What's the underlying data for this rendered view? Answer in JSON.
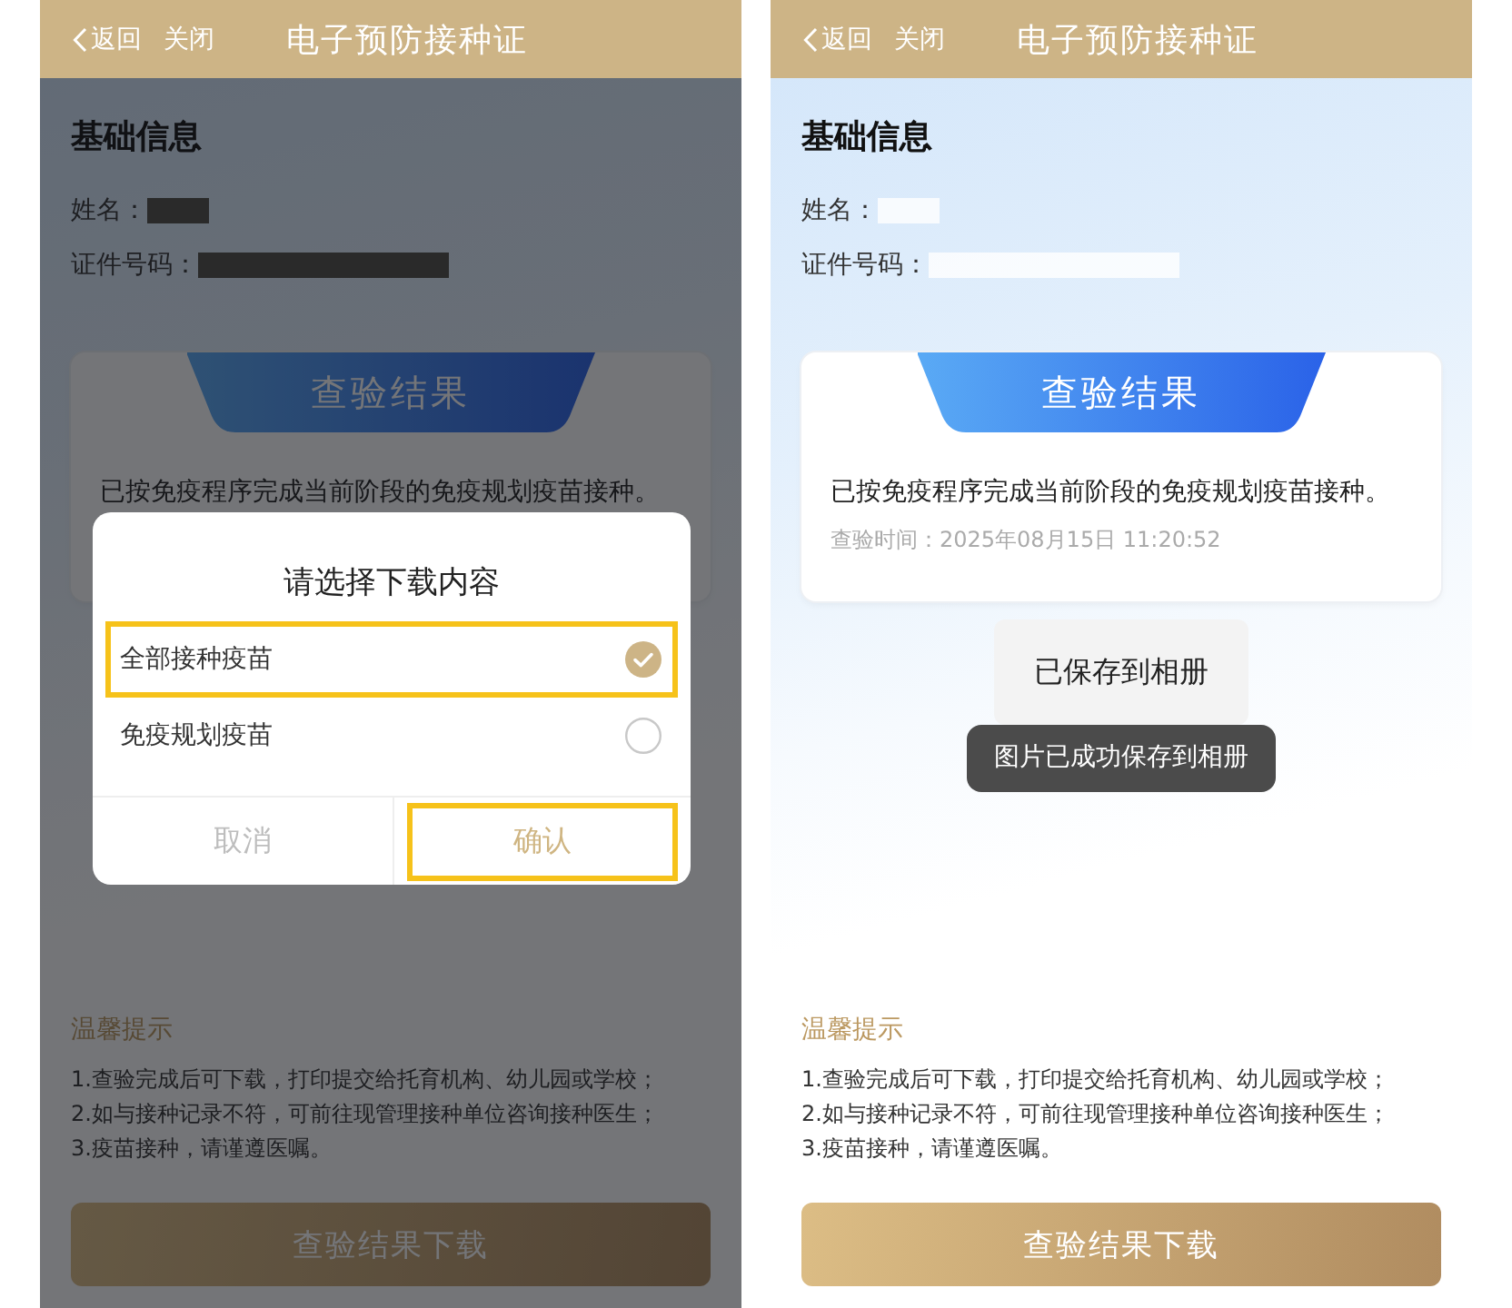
{
  "screens": [
    {
      "header": {
        "back": "返回",
        "close": "关闭",
        "title": "电子预防接种证"
      },
      "basic_info": {
        "heading": "基础信息",
        "fields": [
          {
            "label": "姓名：",
            "redacted": true
          },
          {
            "label": "证件号码：",
            "redacted": true
          }
        ]
      },
      "result_card": {
        "tab": "查验结果",
        "message": "已按免疫程序完成当前阶段的免疫规划疫苗接种。"
      },
      "tips": {
        "heading": "温馨提示",
        "lines": [
          "1.查验完成后可下载，打印提交给托育机构、幼儿园或学校；",
          "2.如与接种记录不符，可前往现管理接种单位咨询接种医生；",
          "3.疫苗接种，请谨遵医嘱。"
        ]
      },
      "download_button": "查验结果下载",
      "dialog": {
        "title": "请选择下载内容",
        "options": [
          {
            "label": "全部接种疫苗",
            "selected": true,
            "highlighted": true
          },
          {
            "label": "免疫规划疫苗",
            "selected": false,
            "highlighted": false
          }
        ],
        "buttons": [
          {
            "kind": "cancel",
            "label": "取消",
            "highlighted": false
          },
          {
            "kind": "confirm",
            "label": "确认",
            "highlighted": true
          }
        ]
      }
    },
    {
      "header": {
        "back": "返回",
        "close": "关闭",
        "title": "电子预防接种证"
      },
      "basic_info": {
        "heading": "基础信息",
        "fields": [
          {
            "label": "姓名：",
            "redacted": true
          },
          {
            "label": "证件号码：",
            "redacted": true
          }
        ]
      },
      "result_card": {
        "tab": "查验结果",
        "message": "已按免疫程序完成当前阶段的免疫规划疫苗接种。",
        "check_time": "查验时间：2025年08月15日 11:20:52"
      },
      "tips": {
        "heading": "温馨提示",
        "lines": [
          "1.查验完成后可下载，打印提交给托育机构、幼儿园或学校；",
          "2.如与接种记录不符，可前往现管理接种单位咨询接种医生；",
          "3.疫苗接种，请谨遵医嘱。"
        ]
      },
      "download_button": "查验结果下载",
      "toasts": [
        {
          "kind": "popup",
          "text": "已保存到相册"
        },
        {
          "kind": "toast",
          "text": "图片已成功保存到相册"
        }
      ]
    }
  ]
}
